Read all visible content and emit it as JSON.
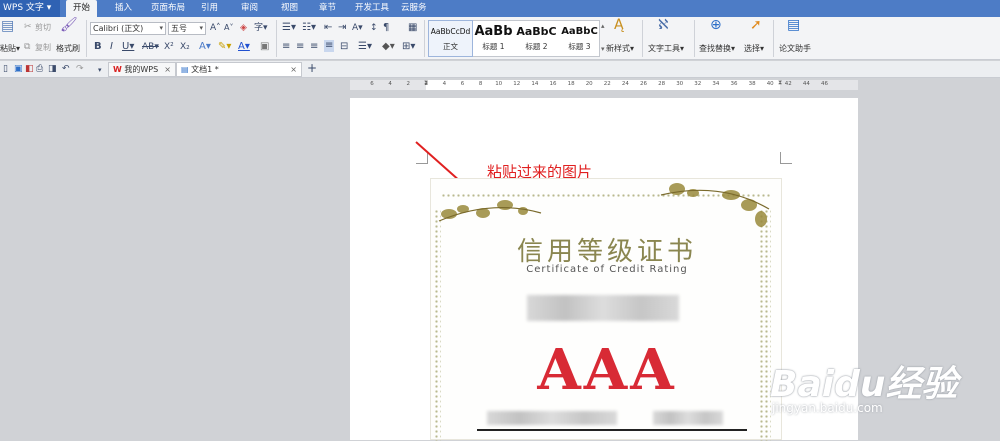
{
  "app": {
    "button_label": "WPS 文字"
  },
  "ribbon_tabs": [
    "开始",
    "插入",
    "页面布局",
    "引用",
    "审阅",
    "视图",
    "章节",
    "开发工具",
    "云服务"
  ],
  "clipboard": {
    "paste": "粘贴",
    "cut": "剪切",
    "copy": "复制",
    "format_painter": "格式刷"
  },
  "font": {
    "family": "Calibri (正文)",
    "size": "五号"
  },
  "styles": [
    {
      "preview": "AaBbCcDd",
      "name": "正文"
    },
    {
      "preview": "AaBb",
      "name": "标题 1"
    },
    {
      "preview": "AaBbC",
      "name": "标题 2"
    },
    {
      "preview": "AaBbC",
      "name": "标题 3"
    }
  ],
  "ribbon_right": {
    "new_style": "新样式",
    "text_tools": "文字工具",
    "find_replace": "查找替换",
    "select": "选择",
    "thesis_assistant": "论文助手"
  },
  "doc_tabs": {
    "home": "我的WPS",
    "doc": "文档1 *"
  },
  "ruler_numbers": [
    "6",
    "4",
    "2",
    "2",
    "4",
    "6",
    "8",
    "10",
    "12",
    "14",
    "16",
    "18",
    "20",
    "22",
    "24",
    "26",
    "28",
    "30",
    "32",
    "34",
    "36",
    "38",
    "40",
    "42",
    "44",
    "46"
  ],
  "annotation": "粘贴过来的图片",
  "certificate": {
    "title": "信用等级证书",
    "subtitle": "Certificate of Credit Rating",
    "rating": "AAA"
  },
  "watermark": {
    "brand": "Baidu经验",
    "url": "jingyan.baidu.com"
  },
  "colors": {
    "tabbar": "#4d7cc6",
    "annotation_red": "#e02020",
    "rating_red": "#d82a35",
    "title_olive": "#8a8650"
  }
}
